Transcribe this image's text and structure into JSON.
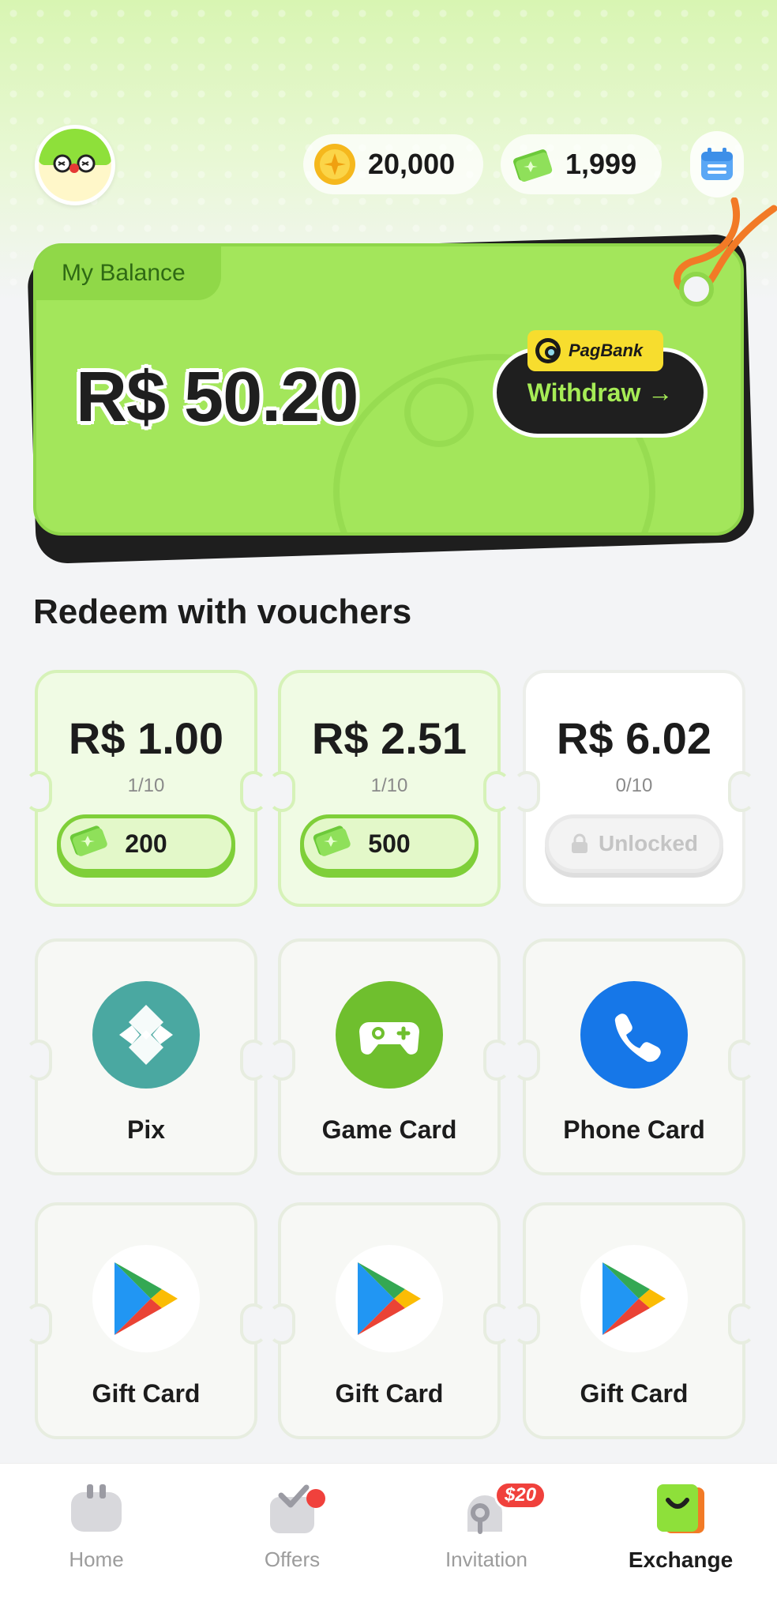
{
  "header": {
    "coins": "20,000",
    "cash": "1,999"
  },
  "balance": {
    "label": "My Balance",
    "amount": "R$ 50.20",
    "withdraw_label": "Withdraw →",
    "provider": "PagBank"
  },
  "section_title": "Redeem with vouchers",
  "vouchers": [
    {
      "amount": "R$ 1.00",
      "count": "1/10",
      "cost": "200",
      "locked": false
    },
    {
      "amount": "R$ 2.51",
      "count": "1/10",
      "cost": "500",
      "locked": false
    },
    {
      "amount": "R$ 6.02",
      "count": "0/10",
      "cost": "Unlocked",
      "locked": true
    }
  ],
  "methods": [
    {
      "label": "Pix",
      "icon": "pix-icon",
      "color": "#4aa8a1"
    },
    {
      "label": "Game Card",
      "icon": "gamepad-icon",
      "color": "#6fbf2e"
    },
    {
      "label": "Phone Card",
      "icon": "phone-icon",
      "color": "#1677e8"
    }
  ],
  "gift_cards": [
    {
      "label": "Gift Card",
      "icon": "google-play-icon"
    },
    {
      "label": "Gift Card",
      "icon": "google-play-icon"
    },
    {
      "label": "Gift Card",
      "icon": "google-play-icon"
    }
  ],
  "nav": {
    "items": [
      {
        "label": "Home",
        "icon": "home-icon"
      },
      {
        "label": "Offers",
        "icon": "offers-icon"
      },
      {
        "label": "Invitation",
        "icon": "invitation-icon",
        "badge": "$20"
      },
      {
        "label": "Exchange",
        "icon": "exchange-icon",
        "active": true
      }
    ]
  },
  "colors": {
    "accent": "#a3e65b",
    "dark": "#1f1f1f",
    "badge": "#f0413c"
  }
}
